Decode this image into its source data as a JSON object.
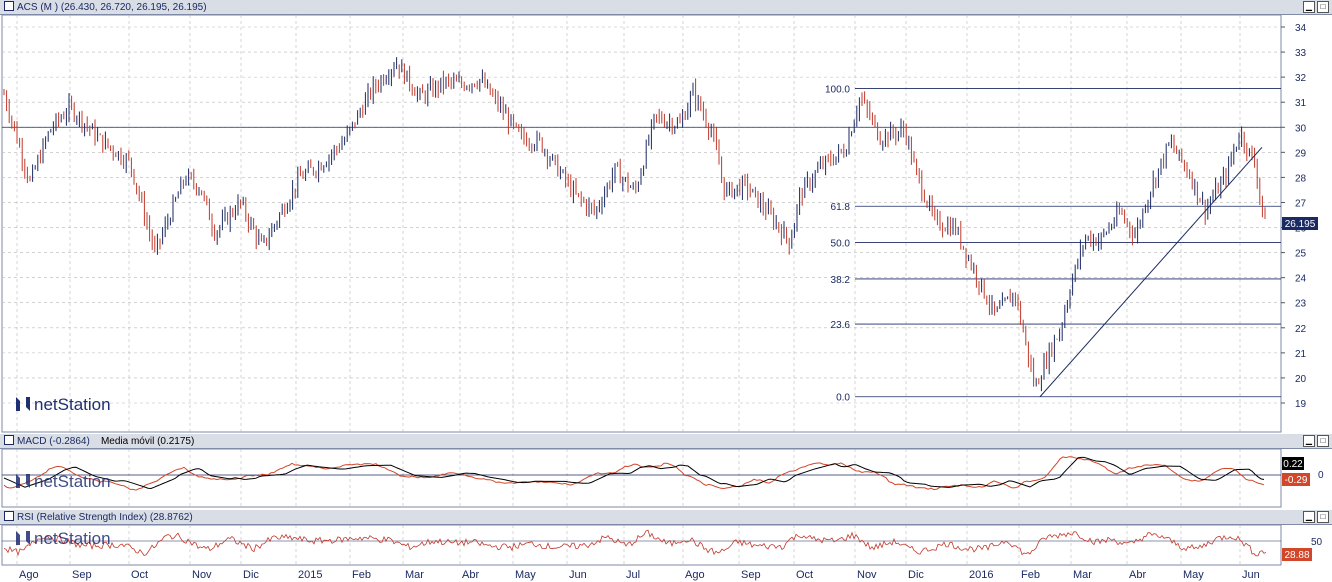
{
  "main_panel": {
    "title": "ACS (M ) (26.430, 26.720, 26.195, 26.195)",
    "last_price_badge": "26.195",
    "y_ticks": [
      "34",
      "33",
      "32",
      "31",
      "30",
      "29",
      "28",
      "27",
      "26",
      "25",
      "24",
      "23",
      "22",
      "21",
      "20",
      "19"
    ],
    "fib_labels": [
      "100.0",
      "61.8",
      "50.0",
      "38.2",
      "23.6",
      "0.0"
    ],
    "watermark": "netStation"
  },
  "macd_panel": {
    "title": "MACD (-0.2864)",
    "title_ma": "Media móvil (0.2175)",
    "y_tick": "0",
    "badge_macd": "0.22",
    "badge_signal": "-0.29",
    "watermark": "netStation"
  },
  "rsi_panel": {
    "title": "RSI (Relative Strength Index) (28.8762)",
    "y_tick": "50",
    "badge": "28.88",
    "watermark": "netStation"
  },
  "x_axis": {
    "labels": [
      "Ago",
      "Sep",
      "Oct",
      "Nov",
      "Dic",
      "2015",
      "Feb",
      "Mar",
      "Abr",
      "May",
      "Jun",
      "Jul",
      "Ago",
      "Sep",
      "Oct",
      "Nov",
      "Dic",
      "2016",
      "Feb",
      "Mar",
      "Abr",
      "May",
      "Jun"
    ]
  },
  "colors": {
    "up": "#1b2a63",
    "down": "#c0392b",
    "fib": "#1b2a63",
    "grid": "#b8b8b8",
    "badge": "#1b2a63",
    "macd_signal": "#d2462a"
  },
  "chart_data": {
    "type": "ohlc",
    "symbol": "ACS",
    "y_range": [
      19,
      34
    ],
    "resistance_level": 30,
    "fibonacci": [
      {
        "label": "100.0",
        "price": 31.55
      },
      {
        "label": "61.8",
        "price": 26.85
      },
      {
        "label": "50.0",
        "price": 25.4
      },
      {
        "label": "38.2",
        "price": 23.95
      },
      {
        "label": "23.6",
        "price": 22.15
      },
      {
        "label": "0.0",
        "price": 19.25
      }
    ],
    "trendline": {
      "from": {
        "month": "Feb 2016",
        "price": 19.25
      },
      "to": {
        "month": "Jun 2016",
        "price": 29.2
      }
    },
    "monthly_closes": [
      {
        "month": "Ago",
        "price": 31.2
      },
      {
        "month": "Sep",
        "price": 29.8
      },
      {
        "month": "Oct",
        "price": 26.8
      },
      {
        "month": "Nov",
        "price": 27.6
      },
      {
        "month": "Dic",
        "price": 25.6
      },
      {
        "month": "2015",
        "price": 27.5
      },
      {
        "month": "Feb",
        "price": 30.4
      },
      {
        "month": "Mar",
        "price": 31.7
      },
      {
        "month": "Abr",
        "price": 31.4
      },
      {
        "month": "May",
        "price": 29.6
      },
      {
        "month": "Jun",
        "price": 27.4
      },
      {
        "month": "Jul",
        "price": 29.7
      },
      {
        "month": "Ago",
        "price": 30.6
      },
      {
        "month": "Sep",
        "price": 26.6
      },
      {
        "month": "Oct",
        "price": 28.3
      },
      {
        "month": "Nov",
        "price": 30.2
      },
      {
        "month": "Dic",
        "price": 27.2
      },
      {
        "month": "2016",
        "price": 23.0
      },
      {
        "month": "Feb",
        "price": 20.3
      },
      {
        "month": "Mar",
        "price": 25.8
      },
      {
        "month": "Abr",
        "price": 28.7
      },
      {
        "month": "May",
        "price": 28.6
      },
      {
        "month": "Jun",
        "price": 26.2
      }
    ],
    "last": {
      "open": 26.43,
      "high": 26.72,
      "low": 26.195,
      "close": 26.195
    },
    "macd": {
      "value": -0.2864,
      "signal": 0.2175
    },
    "rsi": {
      "value": 28.8762
    }
  }
}
